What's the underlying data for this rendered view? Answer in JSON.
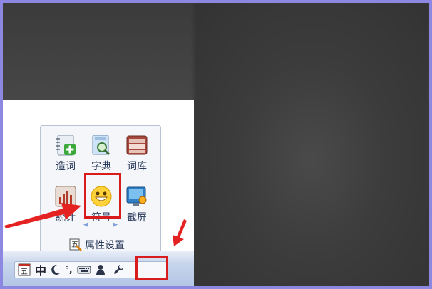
{
  "toolbox": {
    "items": [
      {
        "label": "造词",
        "icon": "notebook-add-icon"
      },
      {
        "label": "字典",
        "icon": "dictionary-search-icon"
      },
      {
        "label": "词库",
        "icon": "word-library-icon"
      },
      {
        "label": "統计",
        "icon": "statistics-chart-icon"
      },
      {
        "label": "符号",
        "icon": "smiley-symbol-icon"
      },
      {
        "label": "截屏",
        "icon": "screenshot-icon"
      }
    ],
    "settings_label": "属性设置"
  },
  "imebar": {
    "mode_label": "中",
    "punct_label": "°,"
  },
  "colors": {
    "highlight": "#d81b1b",
    "arrow": "#e52222",
    "frame": "#8c87e0"
  }
}
